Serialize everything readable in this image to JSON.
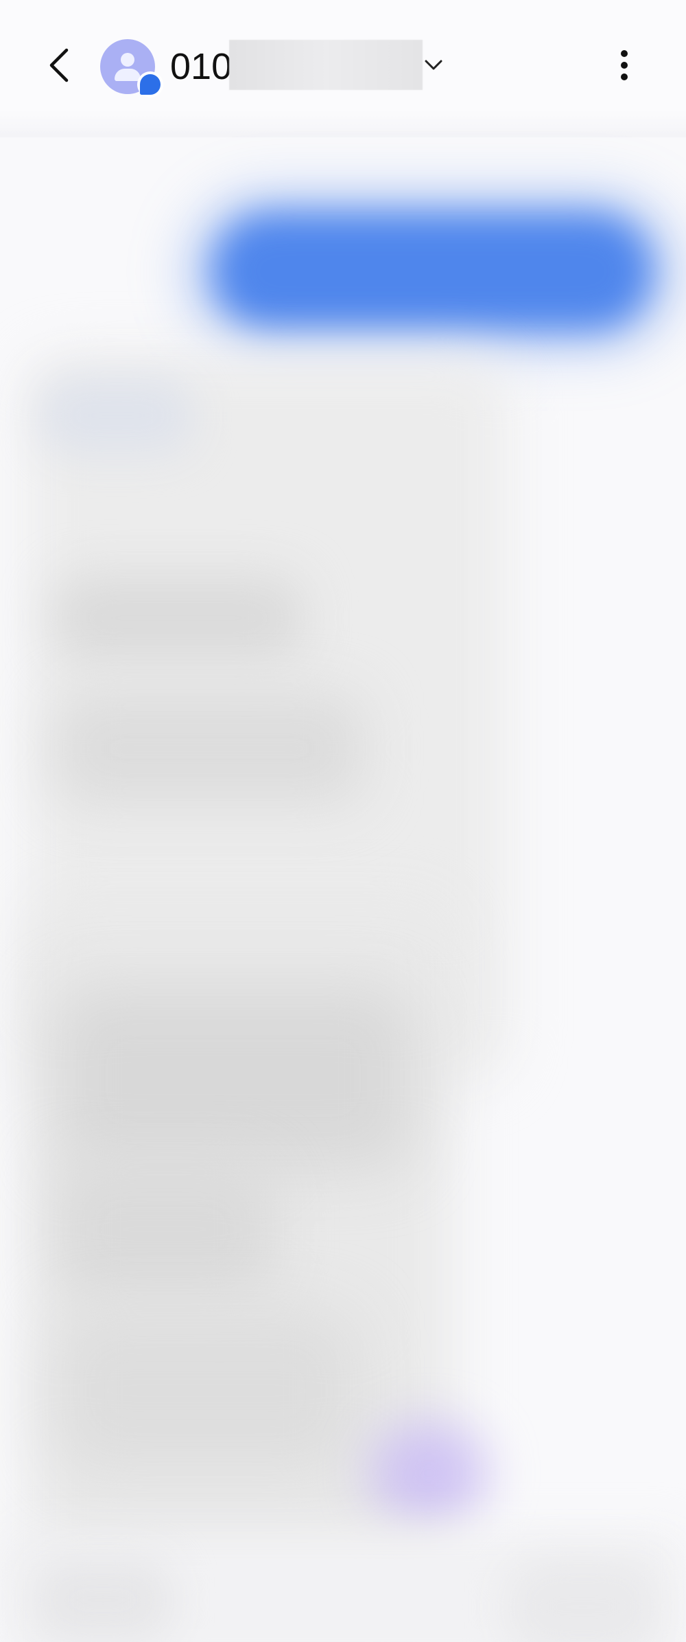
{
  "header": {
    "contact_name": "010",
    "icons": {
      "back": "back-arrow-icon",
      "avatar": "person-icon",
      "badge": "message-bubble-icon",
      "dropdown": "chevron-down-icon",
      "more": "more-vertical-icon"
    }
  },
  "colors": {
    "background": "#f9f9fb",
    "avatar_bg": "#aab0f4",
    "badge_blue": "#2c6fe8",
    "sent_bubble": "#4f86ec",
    "text_primary": "#111111"
  }
}
